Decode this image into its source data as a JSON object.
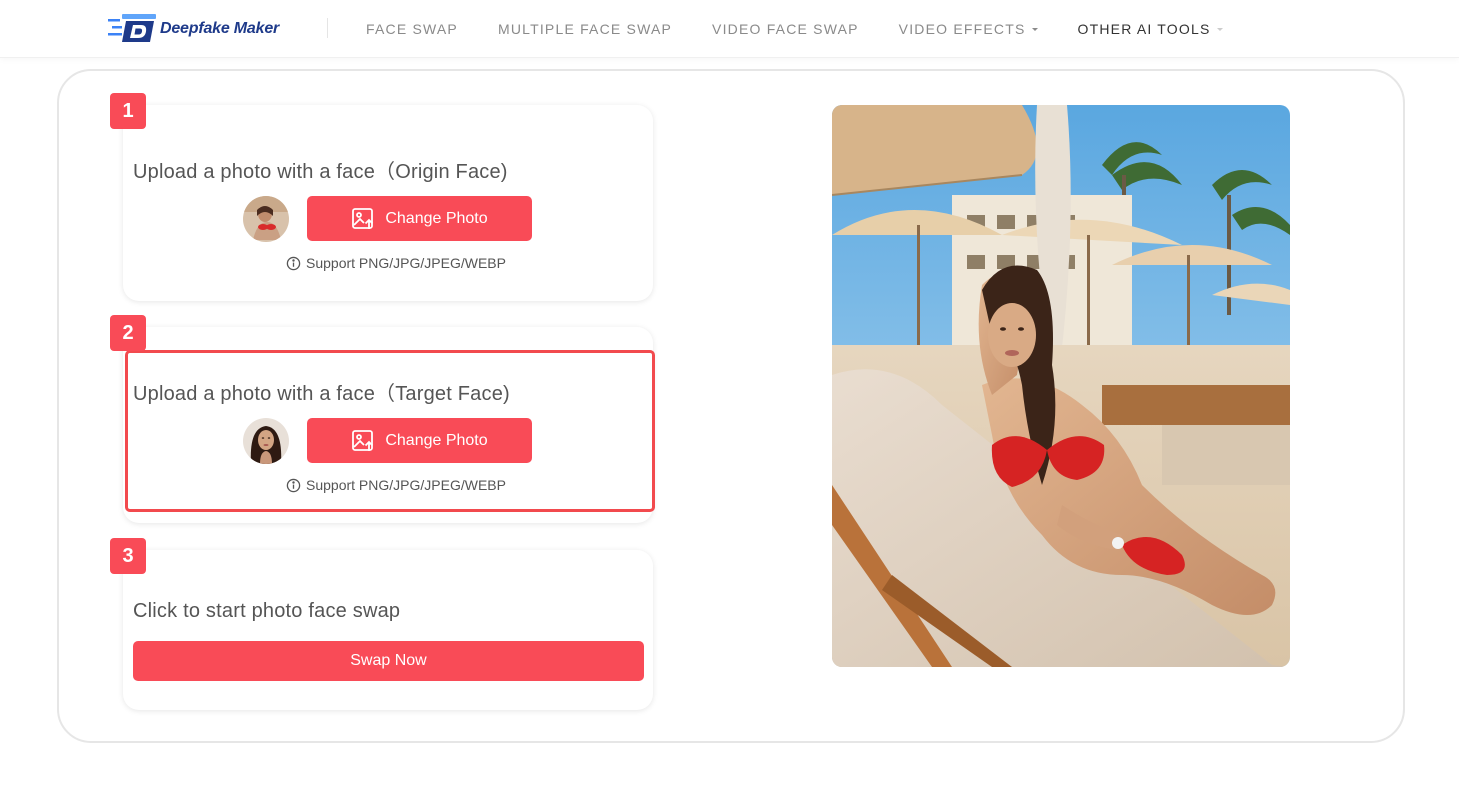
{
  "brand": {
    "name": "Deepfake Maker",
    "logo_letter": "D"
  },
  "nav": {
    "items": [
      {
        "label": "FACE SWAP",
        "active": false,
        "dropdown": false
      },
      {
        "label": "MULTIPLE FACE SWAP",
        "active": false,
        "dropdown": false
      },
      {
        "label": "VIDEO FACE SWAP",
        "active": false,
        "dropdown": false
      },
      {
        "label": "VIDEO EFFECTS",
        "active": false,
        "dropdown": true
      },
      {
        "label": "OTHER AI TOOLS",
        "active": true,
        "dropdown": true
      }
    ]
  },
  "steps": [
    {
      "number": "1",
      "title": "Upload a photo with a face（Origin Face)",
      "button_label": "Change Photo",
      "support_text": "Support PNG/JPG/JPEG/WEBP"
    },
    {
      "number": "2",
      "title": "Upload a photo with a face（Target Face)",
      "button_label": "Change Photo",
      "support_text": "Support PNG/JPG/JPEG/WEBP"
    },
    {
      "number": "3",
      "title": "Click to start photo face swap",
      "button_label": "Swap Now"
    }
  ],
  "colors": {
    "accent": "#f94b57",
    "highlight_border": "#f24a4e",
    "brand_blue": "#1e3a8a",
    "nav_text": "#8a8a8a"
  },
  "icons": {
    "upload": "image-upload-icon",
    "info": "info-circle-icon"
  }
}
